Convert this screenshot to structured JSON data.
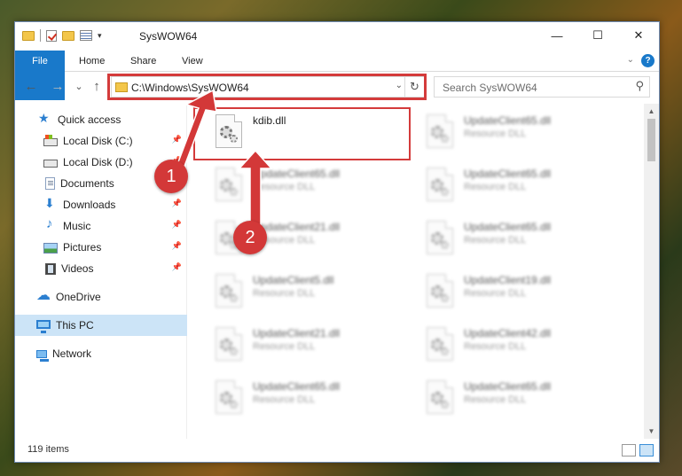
{
  "window": {
    "title": "SysWOW64",
    "minimize": "—",
    "maximize": "☐",
    "close": "✕"
  },
  "ribbon": {
    "tabs": [
      "File",
      "Home",
      "Share",
      "View"
    ],
    "help": "?"
  },
  "nav": {
    "back": "←",
    "forward": "→",
    "recent": "⌄",
    "up": "↑",
    "address": "C:\\Windows\\SysWOW64",
    "search_placeholder": "Search SysWOW64"
  },
  "sidebar": {
    "items": [
      {
        "label": "Quick access",
        "icon": "star-icon"
      },
      {
        "label": "Local Disk (C:)",
        "icon": "local-disk-icon",
        "pinned": true
      },
      {
        "label": "Local Disk (D:)",
        "icon": "local-disk-icon",
        "pinned": true
      },
      {
        "label": "Documents",
        "icon": "documents-icon",
        "pinned": true
      },
      {
        "label": "Downloads",
        "icon": "downloads-icon",
        "pinned": true
      },
      {
        "label": "Music",
        "icon": "music-icon",
        "pinned": true
      },
      {
        "label": "Pictures",
        "icon": "pictures-icon",
        "pinned": true
      },
      {
        "label": "Videos",
        "icon": "videos-icon",
        "pinned": true
      },
      {
        "label": "OneDrive",
        "icon": "onedrive-icon"
      },
      {
        "label": "This PC",
        "icon": "this-pc-icon",
        "selected": true
      },
      {
        "label": "Network",
        "icon": "network-icon"
      }
    ]
  },
  "files": [
    {
      "name": "kdib.dll",
      "type": ""
    },
    {
      "name": "UpdateClient65.dll",
      "type": "Resource DLL"
    },
    {
      "name": "UpdateClient65.dll",
      "type": "Resource DLL"
    },
    {
      "name": "UpdateClient65.dll",
      "type": "Resource DLL"
    },
    {
      "name": "UpdateClient21.dll",
      "type": "Resource DLL"
    },
    {
      "name": "UpdateClient65.dll",
      "type": "Resource DLL"
    },
    {
      "name": "UpdateClient5.dll",
      "type": "Resource DLL"
    },
    {
      "name": "UpdateClient19.dll",
      "type": "Resource DLL"
    },
    {
      "name": "UpdateClient21.dll",
      "type": "Resource DLL"
    },
    {
      "name": "UpdateClient42.dll",
      "type": "Resource DLL"
    },
    {
      "name": "UpdateClient65.dll",
      "type": "Resource DLL"
    },
    {
      "name": "UpdateClient65.dll",
      "type": "Resource DLL"
    }
  ],
  "status": {
    "item_count": "119 items"
  },
  "annotations": {
    "marker1": "1",
    "marker2": "2",
    "highlight_color": "#d43b3b"
  }
}
